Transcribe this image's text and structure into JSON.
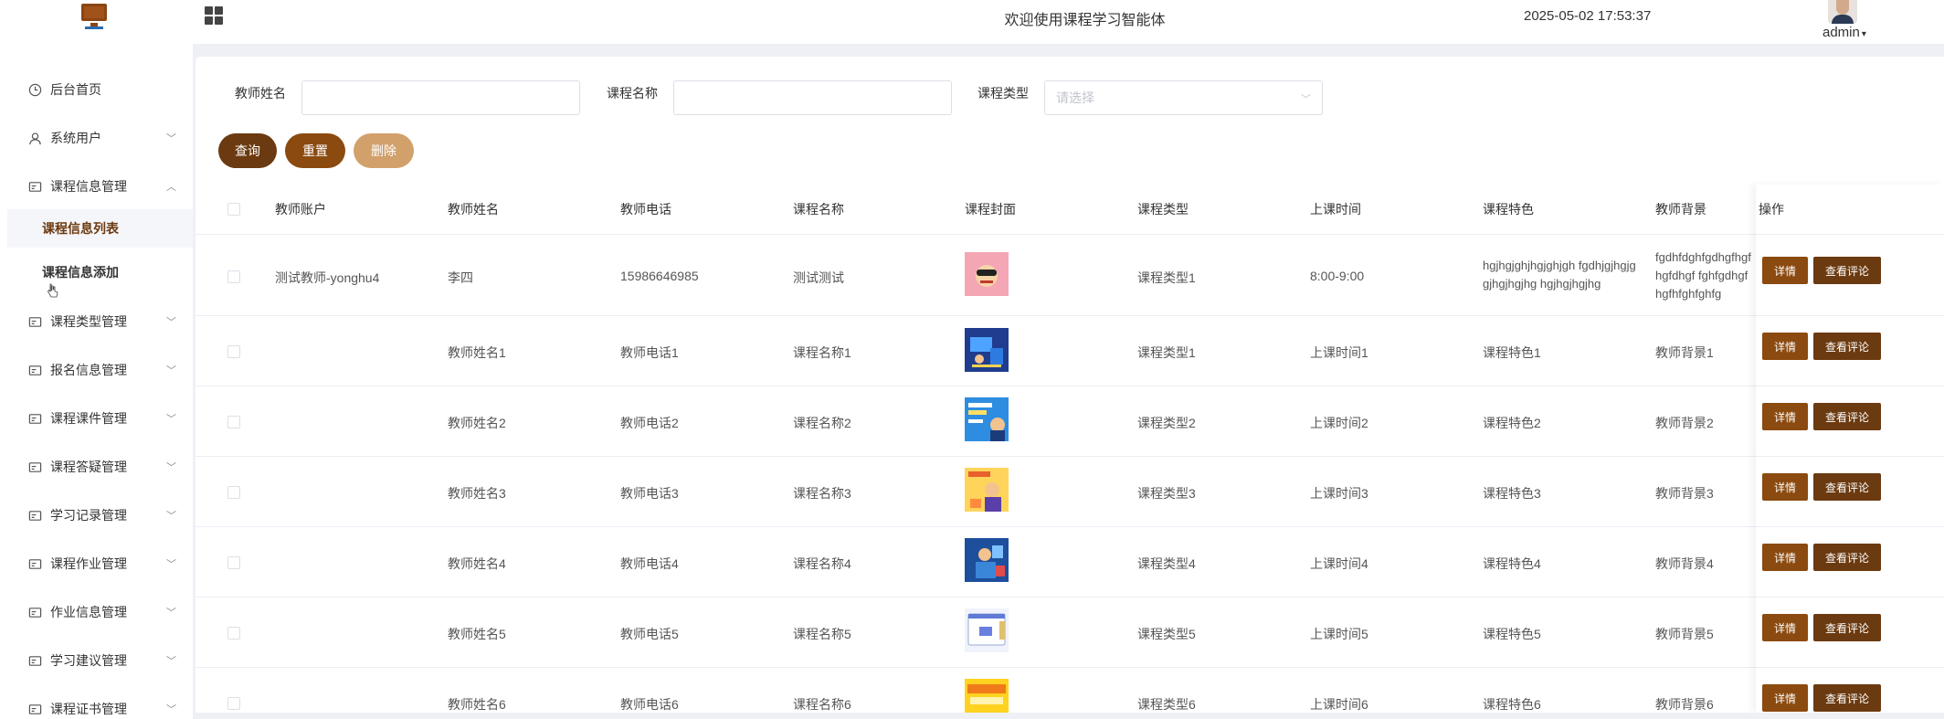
{
  "header": {
    "welcome": "欢迎使用课程学习智能体",
    "datetime": "2025-05-02 17:53:37",
    "user": "admin"
  },
  "sidebar": {
    "items": [
      {
        "label": "后台首页",
        "icon": "clock-icon"
      },
      {
        "label": "系统用户",
        "icon": "user-icon"
      },
      {
        "label": "课程信息管理",
        "icon": "card-icon",
        "expanded": true
      },
      {
        "label": "课程类型管理",
        "icon": "card-icon"
      },
      {
        "label": "报名信息管理",
        "icon": "card-icon"
      },
      {
        "label": "课程课件管理",
        "icon": "card-icon"
      },
      {
        "label": "课程答疑管理",
        "icon": "card-icon"
      },
      {
        "label": "学习记录管理",
        "icon": "card-icon"
      },
      {
        "label": "课程作业管理",
        "icon": "card-icon"
      },
      {
        "label": "作业信息管理",
        "icon": "card-icon"
      },
      {
        "label": "学习建议管理",
        "icon": "card-icon"
      },
      {
        "label": "课程证书管理",
        "icon": "card-icon"
      }
    ],
    "subitems": [
      {
        "label": "课程信息列表",
        "active": true
      },
      {
        "label": "课程信息添加",
        "active": false
      }
    ]
  },
  "filters": {
    "teacher_name_label": "教师姓名",
    "course_name_label": "课程名称",
    "course_type_label": "课程类型",
    "course_type_placeholder": "请选择"
  },
  "buttons": {
    "query": "查询",
    "reset": "重置",
    "delete": "删除"
  },
  "colors": {
    "query": "#6b3a10",
    "reset": "#8b4a0f",
    "delete": "#d2a06a"
  },
  "table": {
    "headers": [
      "教师账户",
      "教师姓名",
      "教师电话",
      "课程名称",
      "课程封面",
      "课程类型",
      "上课时间",
      "课程特色",
      "教师背景",
      "操作"
    ],
    "rows": [
      {
        "account": "测试教师-yonghu4",
        "name": "李四",
        "phone": "15986646985",
        "course": "测试测试",
        "type": "课程类型1",
        "time": "8:00-9:00",
        "feature": "hgjhgjghjhgjghjgh fgdhjgjhgjg gjhgjhgjhg hgjhgjhgjhg",
        "background": "fgdhfdghfgdhgfhgfhgfdhgf fghfgdhgfhgfhfghfghfg"
      },
      {
        "account": "",
        "name": "教师姓名1",
        "phone": "教师电话1",
        "course": "课程名称1",
        "type": "课程类型1",
        "time": "上课时间1",
        "feature": "课程特色1",
        "background": "教师背景1"
      },
      {
        "account": "",
        "name": "教师姓名2",
        "phone": "教师电话2",
        "course": "课程名称2",
        "type": "课程类型2",
        "time": "上课时间2",
        "feature": "课程特色2",
        "background": "教师背景2"
      },
      {
        "account": "",
        "name": "教师姓名3",
        "phone": "教师电话3",
        "course": "课程名称3",
        "type": "课程类型3",
        "time": "上课时间3",
        "feature": "课程特色3",
        "background": "教师背景3"
      },
      {
        "account": "",
        "name": "教师姓名4",
        "phone": "教师电话4",
        "course": "课程名称4",
        "type": "课程类型4",
        "time": "上课时间4",
        "feature": "课程特色4",
        "background": "教师背景4"
      },
      {
        "account": "",
        "name": "教师姓名5",
        "phone": "教师电话5",
        "course": "课程名称5",
        "type": "课程类型5",
        "time": "上课时间5",
        "feature": "课程特色5",
        "background": "教师背景5"
      },
      {
        "account": "",
        "name": "教师姓名6",
        "phone": "教师电话6",
        "course": "课程名称6",
        "type": "课程类型6",
        "time": "上课时间6",
        "feature": "课程特色6",
        "background": "教师背景6"
      }
    ],
    "row_actions": {
      "detail": "详情",
      "review": "查看评论"
    }
  }
}
